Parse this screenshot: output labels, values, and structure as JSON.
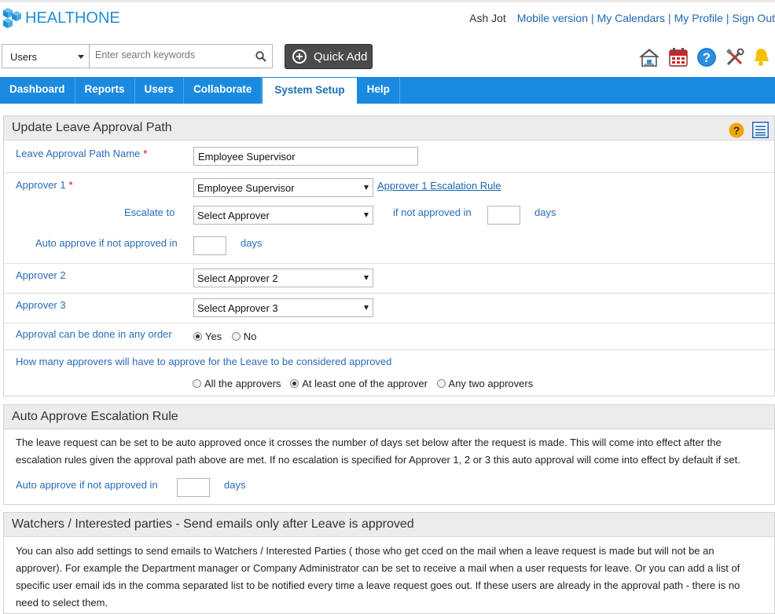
{
  "header": {
    "logo_text_health": "HEALTH",
    "logo_text_one": "ONE",
    "user_name": "Ash Jot",
    "links": [
      "Mobile version",
      "My Calendars",
      "My Profile",
      "Sign Out"
    ]
  },
  "search": {
    "scope_value": "Users",
    "placeholder": "Enter search keywords",
    "quick_add_label": "Quick Add"
  },
  "toolbar_icons": [
    "home-icon",
    "calendar-icon",
    "help-icon",
    "tools-icon",
    "bell-icon"
  ],
  "nav": {
    "items": [
      "Dashboard",
      "Reports",
      "Users",
      "Collaborate",
      "System Setup",
      "Help"
    ],
    "active": "System Setup"
  },
  "approval_path": {
    "title": "Update Leave Approval Path",
    "name_label": "Leave Approval Path Name",
    "name_value": "Employee Supervisor",
    "approver1_label": "Approver 1",
    "approver1_value": "Employee Supervisor",
    "escalation_rule_link": "Approver 1 Escalation Rule",
    "escalate_to_label": "Escalate to",
    "escalate_to_value": "Select Approver",
    "if_not_approved_label": "if not approved in",
    "days_label": "days",
    "auto_approve_label": "Auto approve if not approved in",
    "approver2_label": "Approver 2",
    "approver2_value": "Select Approver 2",
    "approver3_label": "Approver 3",
    "approver3_value": "Select Approver 3",
    "any_order_label": "Approval can be done in any order",
    "yes_label": "Yes",
    "no_label": "No",
    "how_many_label": "How many approvers will have to approve for the Leave to be considered approved",
    "opt_all": "All the approvers",
    "opt_one": "At least one of the approver",
    "opt_two": "Any two approvers"
  },
  "auto_approve": {
    "title": "Auto Approve Escalation Rule",
    "description_line1": "The leave request can be set to be auto approved once it crosses the number of days set below after the request is made. This will come into effect after the",
    "description_line2": "escalation rules given the approval path above are met. If no escalation is specified for Approver 1, 2 or 3 this auto approval will come into effect by default if set.",
    "label": "Auto approve if not approved in",
    "days_label": "days"
  },
  "watchers": {
    "title": "Watchers / Interested parties - Send emails only after Leave is approved",
    "line1": "You can also add settings to send emails to Watchers / Interested Parties ( those who get cced on the mail when a leave request is made but will not be an",
    "line2": "approver). For example the Department manager or Company Administrator can be set to receive a mail when a user requests for leave. Or you can add a list of",
    "line3": "specific user email ids in the comma separated list to be notified every time a leave request goes out. If these users are already in the approval path - there is no",
    "line4": "need to select them."
  }
}
